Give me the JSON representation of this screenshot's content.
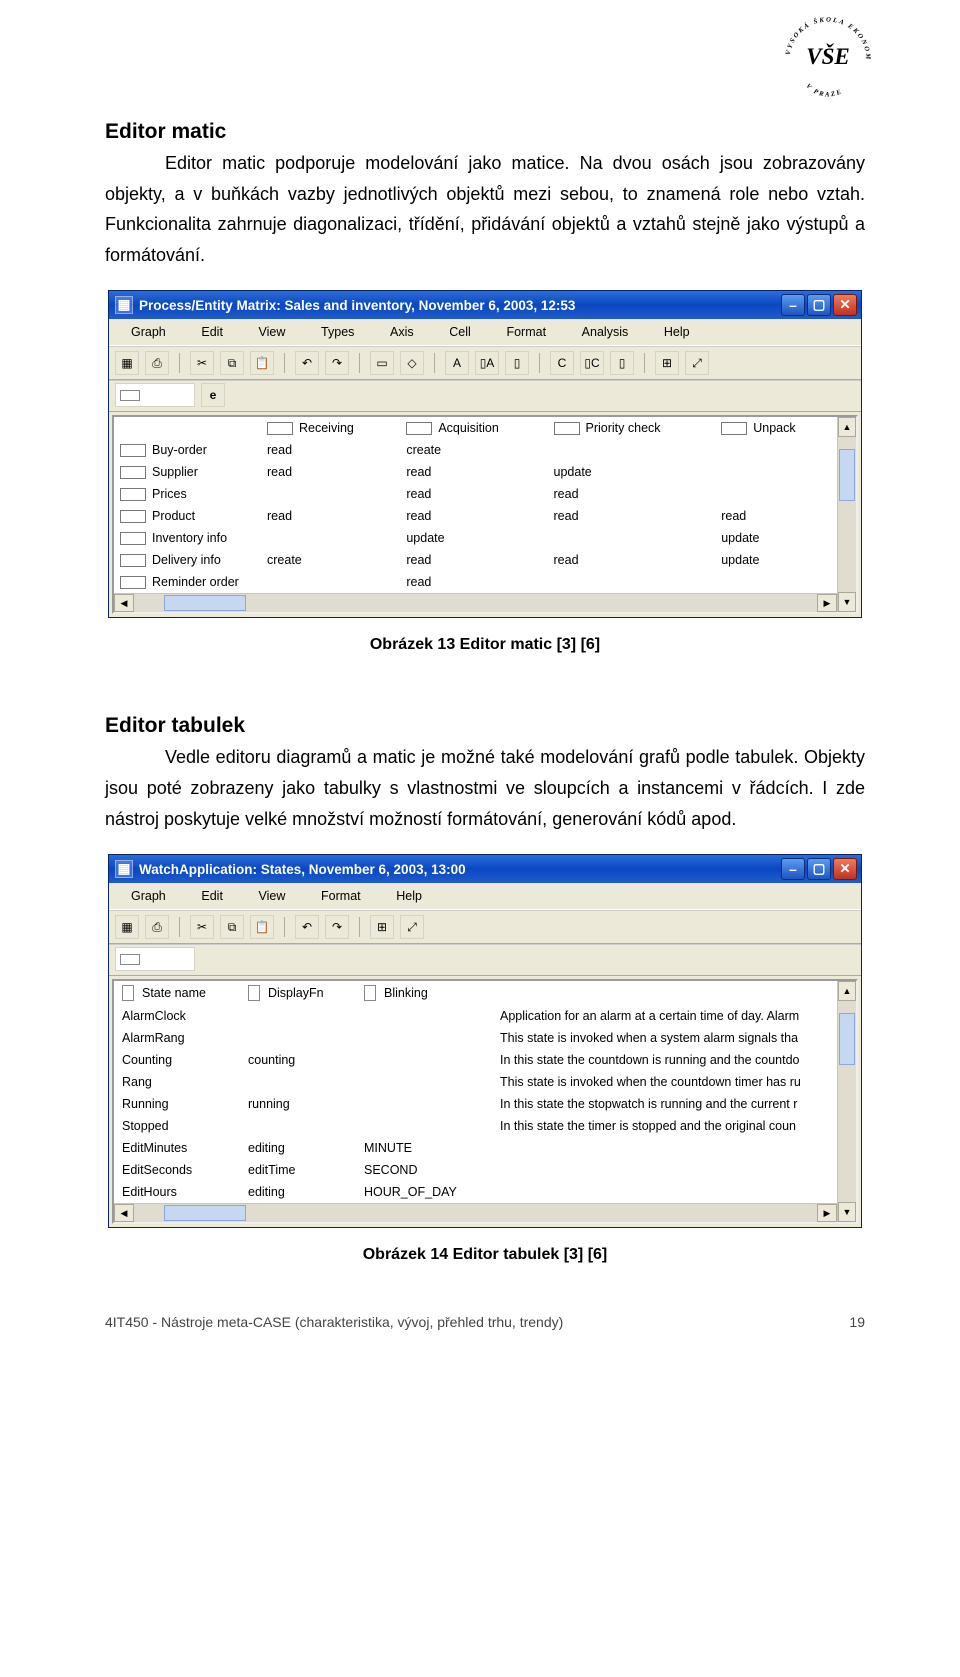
{
  "logo": {
    "top": "ŠKOLA EKONOMICKÁ",
    "bottom": "V PRAZE",
    "center": "VŠE",
    "leftword": "VYSOKÁ"
  },
  "doc": {
    "section1_title": "Editor matic",
    "section1_p1": "Editor matic podporuje modelování jako matice. Na dvou osách jsou zobrazovány objekty, a v buňkách vazby jednotlivých objektů mezi sebou, to znamená role nebo vztah. Funkcionalita zahrnuje diagonalizaci, třídění, přidávání objektů a vztahů stejně jako výstupů a formátování.",
    "caption1": "Obrázek 13 Editor matic [3] [6]",
    "section2_title": "Editor tabulek",
    "section2_p1": "Vedle editoru diagramů a matic je možné také modelování grafů podle tabulek. Objekty jsou poté zobrazeny jako tabulky s vlastnostmi ve sloupcích a instancemi v řádcích. I zde nástroj poskytuje velké množství možností formátování, generování kódů apod.",
    "caption2": "Obrázek 14 Editor tabulek [3] [6]",
    "footer_left": "4IT450 - Nástroje meta-CASE (charakteristika, vývoj, přehled trhu, trendy)",
    "footer_right": "19"
  },
  "window1": {
    "title": "Process/Entity Matrix: Sales and inventory, November 6, 2003, 12:53",
    "menu": [
      "Graph",
      "Edit",
      "View",
      "Types",
      "Axis",
      "Cell",
      "Format",
      "Analysis",
      "Help"
    ],
    "columns": [
      "Receiving",
      "Acquisition",
      "Priority check",
      "Unpack"
    ],
    "rows": [
      {
        "label": "Buy-order",
        "cells": [
          "read",
          "create",
          "",
          ""
        ]
      },
      {
        "label": "Supplier",
        "cells": [
          "read",
          "read",
          "update",
          ""
        ]
      },
      {
        "label": "Prices",
        "cells": [
          "",
          "read",
          "read",
          ""
        ]
      },
      {
        "label": "Product",
        "cells": [
          "read",
          "read",
          "read",
          "read"
        ]
      },
      {
        "label": "Inventory info",
        "cells": [
          "",
          "update",
          "",
          "update"
        ]
      },
      {
        "label": "Delivery info",
        "cells": [
          "create",
          "read",
          "read",
          "update"
        ]
      },
      {
        "label": "Reminder order",
        "cells": [
          "",
          "read",
          "",
          ""
        ]
      }
    ]
  },
  "window2": {
    "title": "WatchApplication: States, November 6, 2003, 13:00",
    "menu": [
      "Graph",
      "Edit",
      "View",
      "Format",
      "Help"
    ],
    "columns": [
      "State name",
      "DisplayFn",
      "Blinking",
      ""
    ],
    "rows": [
      {
        "cells": [
          "AlarmClock",
          "",
          "",
          "Application for an alarm at a certain time of day. Alarm"
        ]
      },
      {
        "cells": [
          "AlarmRang",
          "",
          "",
          "This state is invoked when a system alarm signals tha"
        ]
      },
      {
        "cells": [
          "Counting",
          "counting",
          "",
          "In this state the countdown is running and the countdo"
        ]
      },
      {
        "cells": [
          "Rang",
          "",
          "",
          "This state is invoked when the countdown timer has ru"
        ]
      },
      {
        "cells": [
          "Running",
          "running",
          "",
          "In this state the stopwatch is running and the current r"
        ]
      },
      {
        "cells": [
          "Stopped",
          "",
          "",
          "In this state the timer is stopped and the original coun"
        ]
      },
      {
        "cells": [
          "EditMinutes",
          "editing",
          "MINUTE",
          ""
        ]
      },
      {
        "cells": [
          "EditSeconds",
          "editTime",
          "SECOND",
          ""
        ]
      },
      {
        "cells": [
          "EditHours",
          "editing",
          "HOUR_OF_DAY",
          ""
        ]
      }
    ]
  }
}
